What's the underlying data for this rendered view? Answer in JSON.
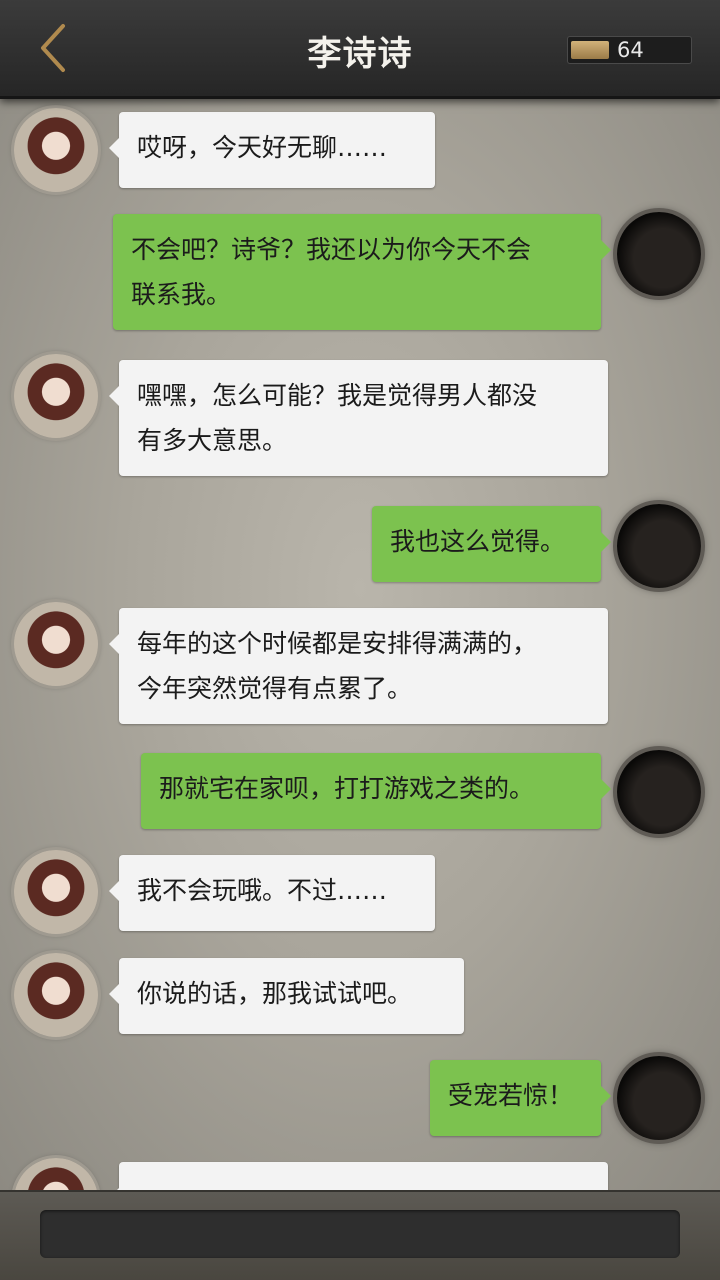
{
  "header": {
    "title": "李诗诗",
    "coins": "64",
    "back_icon": "chevron-left-icon",
    "coin_icon": "gold-bar-icon"
  },
  "messages": [
    {
      "from": "her",
      "text": "哎呀，今天好无聊……"
    },
    {
      "from": "me",
      "text": "不会吧？诗爷？我还以为你今天不会\n联系我。"
    },
    {
      "from": "her",
      "text": "嘿嘿，怎么可能？我是觉得男人都没\n有多大意思。"
    },
    {
      "from": "me",
      "text": "我也这么觉得。"
    },
    {
      "from": "her",
      "text": "每年的这个时候都是安排得满满的，\n今年突然觉得有点累了。"
    },
    {
      "from": "me",
      "text": "那就宅在家呗，打打游戏之类的。"
    },
    {
      "from": "her",
      "text": "我不会玩哦。不过……"
    },
    {
      "from": "her",
      "text": "你说的话，那我试试吧。"
    },
    {
      "from": "me",
      "text": "受宠若惊！"
    }
  ]
}
